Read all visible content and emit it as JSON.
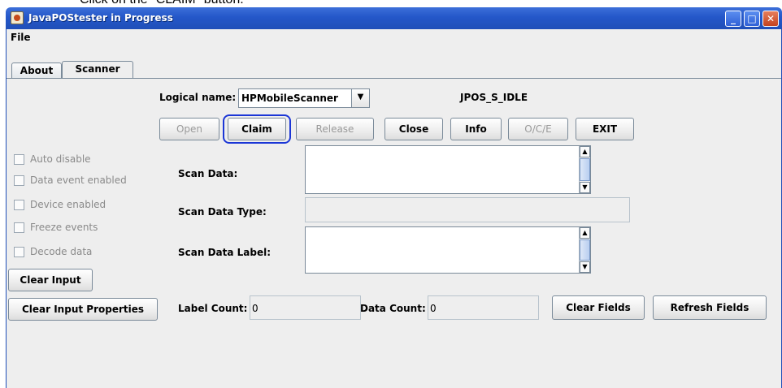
{
  "caption": "Click on the \"CLAIM\" button.",
  "window": {
    "title": "JavaPOStester in Progress",
    "minimize_symbol": "_",
    "maximize_symbol": "□",
    "close_symbol": "✕",
    "app_icon": "java-icon"
  },
  "menu": {
    "file": "File"
  },
  "tabs": [
    {
      "label": "About",
      "active": false
    },
    {
      "label": "Scanner",
      "active": true
    }
  ],
  "scanner": {
    "logical_name_label": "Logical name:",
    "logical_name_value": "HPMobileScanner",
    "state": "JPOS_S_IDLE",
    "buttons": {
      "open": "Open",
      "claim": "Claim",
      "release": "Release",
      "close": "Close",
      "info": "Info",
      "oce": "O/C/E",
      "exit": "EXIT"
    },
    "checkboxes": [
      {
        "label": "Auto disable",
        "checked": false,
        "enabled": false
      },
      {
        "label": "Data event enabled",
        "checked": false,
        "enabled": false
      },
      {
        "label": "Device enabled",
        "checked": false,
        "enabled": false
      },
      {
        "label": "Freeze events",
        "checked": false,
        "enabled": false
      },
      {
        "label": "Decode data",
        "checked": false,
        "enabled": false
      }
    ],
    "clear_input": "Clear Input",
    "clear_input_properties": "Clear Input Properties",
    "scan_data_label": "Scan Data:",
    "scan_data_value": "",
    "scan_data_type_label": "Scan Data Type:",
    "scan_data_type_value": "",
    "scan_data_label_label": "Scan Data Label:",
    "scan_data_label_value": "",
    "label_count_label": "Label Count:",
    "label_count_value": "0",
    "data_count_label": "Data Count:",
    "data_count_value": "0",
    "clear_fields": "Clear Fields",
    "refresh_fields": "Refresh Fields"
  },
  "colors": {
    "titlebar": "#2457c9",
    "highlight": "#1b36d6",
    "panel": "#eeeeee"
  }
}
